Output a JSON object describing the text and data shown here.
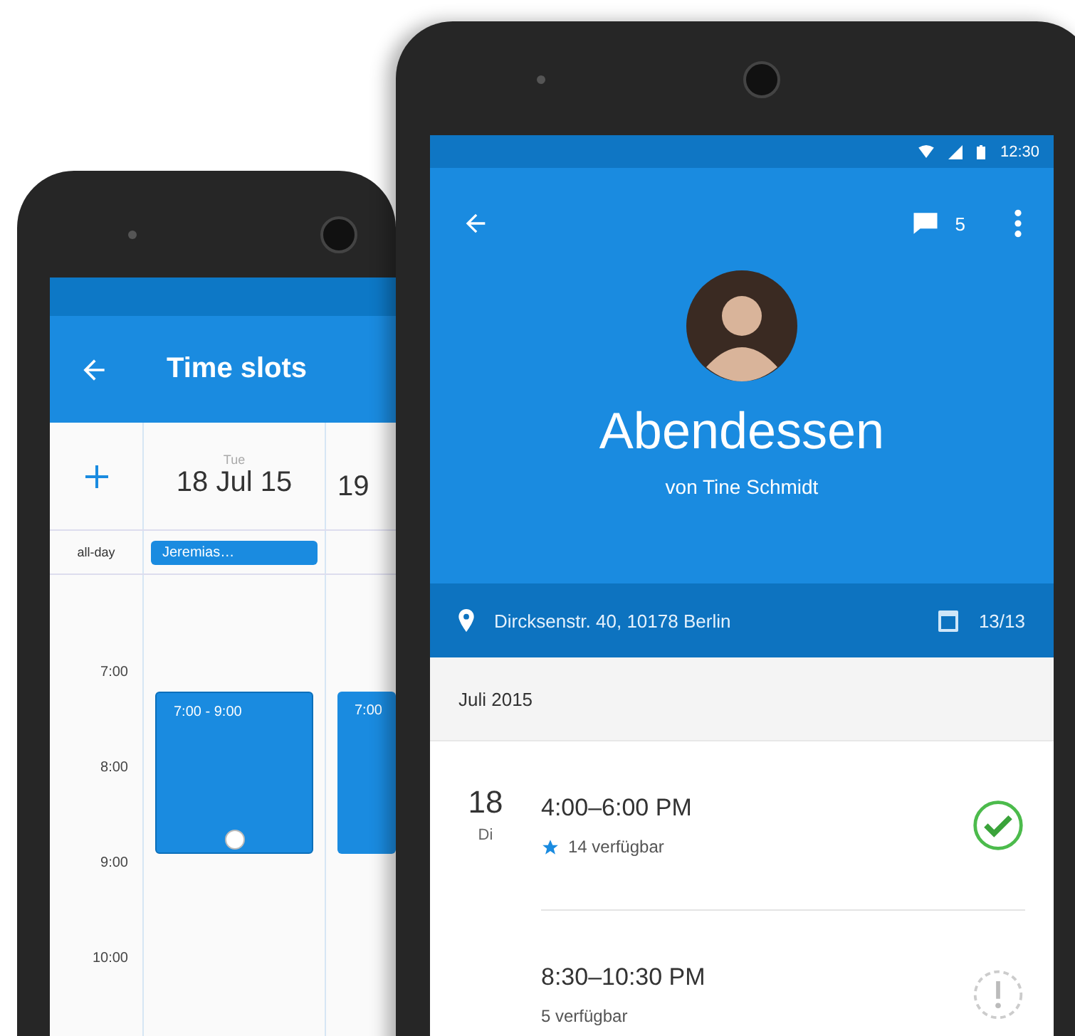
{
  "back_phone": {
    "app_bar": {
      "title": "Time slots"
    },
    "days": [
      {
        "weekday": "Tue",
        "date": "18 Jul 15"
      },
      {
        "date": "19"
      }
    ],
    "all_day_label": "all-day",
    "all_day_events": [
      "Jeremias…"
    ],
    "hours": [
      "7:00",
      "8:00",
      "9:00",
      "10:00"
    ],
    "events": [
      {
        "label": "7:00 - 9:00",
        "selected": true
      },
      {
        "label": "7:00",
        "selected": false
      }
    ]
  },
  "front_phone": {
    "status_bar": {
      "time": "12:30"
    },
    "app_bar": {
      "comment_count": "5"
    },
    "event": {
      "title": "Abendessen",
      "organizer": "von Tine Schmidt"
    },
    "location": "Dircksenstr. 40, 10178 Berlin",
    "participants": "13/13",
    "month": "Juli 2015",
    "day": {
      "number": "18",
      "weekday": "Di"
    },
    "slots": [
      {
        "time": "4:00–6:00 PM",
        "availability": "14 verfügbar",
        "starred": true,
        "confirmed": true
      },
      {
        "time": "8:30–10:30 PM",
        "availability": "5 verfügbar",
        "starred": false,
        "confirmed": false
      }
    ]
  }
}
